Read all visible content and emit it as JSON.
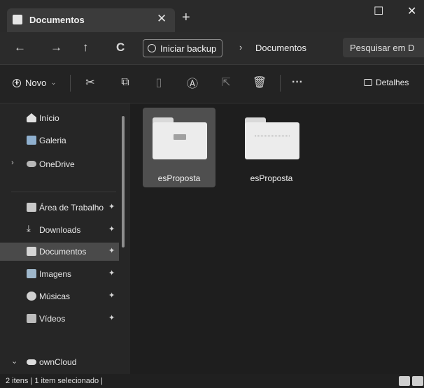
{
  "colors": {
    "accent_folder": "#ececec",
    "selection": "#4f4f4f",
    "onedrive": "#5aa0e0"
  },
  "tab": {
    "title": "Documentos",
    "close_glyph": "✕",
    "new_tab_glyph": "+"
  },
  "window_controls": {
    "minimize": "–",
    "maximize": "☐",
    "close": "✕"
  },
  "navigation": {
    "back": "←",
    "forward": "→",
    "up": "↑",
    "refresh": "C",
    "backup_label": "Iniciar backup",
    "separator": "›",
    "current_folder": "Documentos",
    "search_placeholder": "Pesquisar em D"
  },
  "command_bar": {
    "new_label": "Novo",
    "new_chevron": "⌄",
    "more": "···",
    "details_label": "Detalhes"
  },
  "sidebar": {
    "items": [
      {
        "label": "Início",
        "icon": "home-icon"
      },
      {
        "label": "Galeria",
        "icon": "gallery-icon"
      },
      {
        "label": "OneDrive",
        "icon": "cloud-icon",
        "expander": "›"
      },
      {
        "label": "Área de Trabalho",
        "icon": "desktop-icon",
        "pinned": true
      },
      {
        "label": "Downloads",
        "icon": "download-icon",
        "pinned": true
      },
      {
        "label": "Documentos",
        "icon": "documents-icon",
        "pinned": true,
        "selected": true
      },
      {
        "label": "Imagens",
        "icon": "pictures-icon",
        "pinned": true
      },
      {
        "label": "Músicas",
        "icon": "music-icon",
        "pinned": true
      },
      {
        "label": "Vídeos",
        "icon": "videos-icon",
        "pinned": true
      },
      {
        "label": "ownCloud",
        "icon": "cloud-icon",
        "expander": "⌄"
      }
    ],
    "pin_glyph": "✦"
  },
  "content": {
    "items": [
      {
        "label": "esProposta",
        "selected": true
      },
      {
        "label": "esProposta",
        "selected": false
      }
    ]
  },
  "status": {
    "text": "2 itens  |  1 item selecionado  |"
  }
}
